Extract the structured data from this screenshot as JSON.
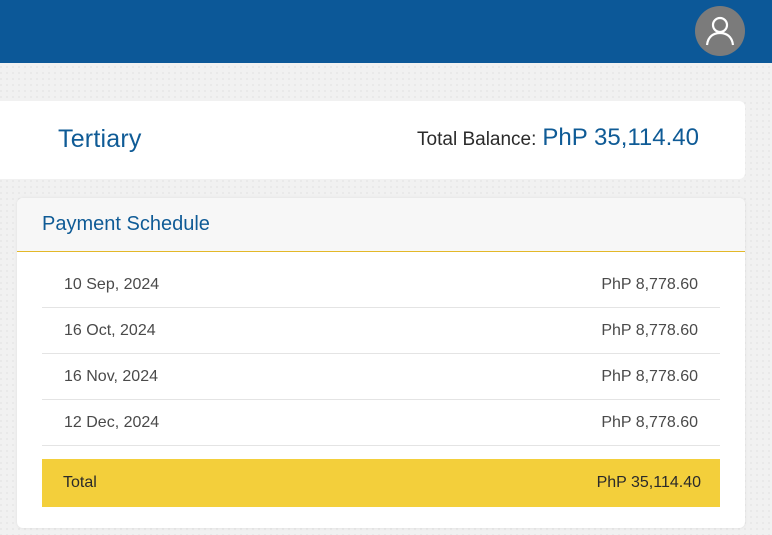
{
  "header": {
    "avatar_icon": "user-icon",
    "bar_color": "#0c5898"
  },
  "balance": {
    "program": "Tertiary",
    "label": "Total Balance:",
    "value": "PhP 35,114.40"
  },
  "schedule": {
    "title": "Payment Schedule",
    "rows": [
      {
        "date": "10 Sep, 2024",
        "amount": "PhP 8,778.60"
      },
      {
        "date": "16 Oct, 2024",
        "amount": "PhP 8,778.60"
      },
      {
        "date": "16 Nov, 2024",
        "amount": "PhP 8,778.60"
      },
      {
        "date": "12 Dec, 2024",
        "amount": "PhP 8,778.60"
      }
    ],
    "total_label": "Total",
    "total_value": "PhP 35,114.40"
  }
}
